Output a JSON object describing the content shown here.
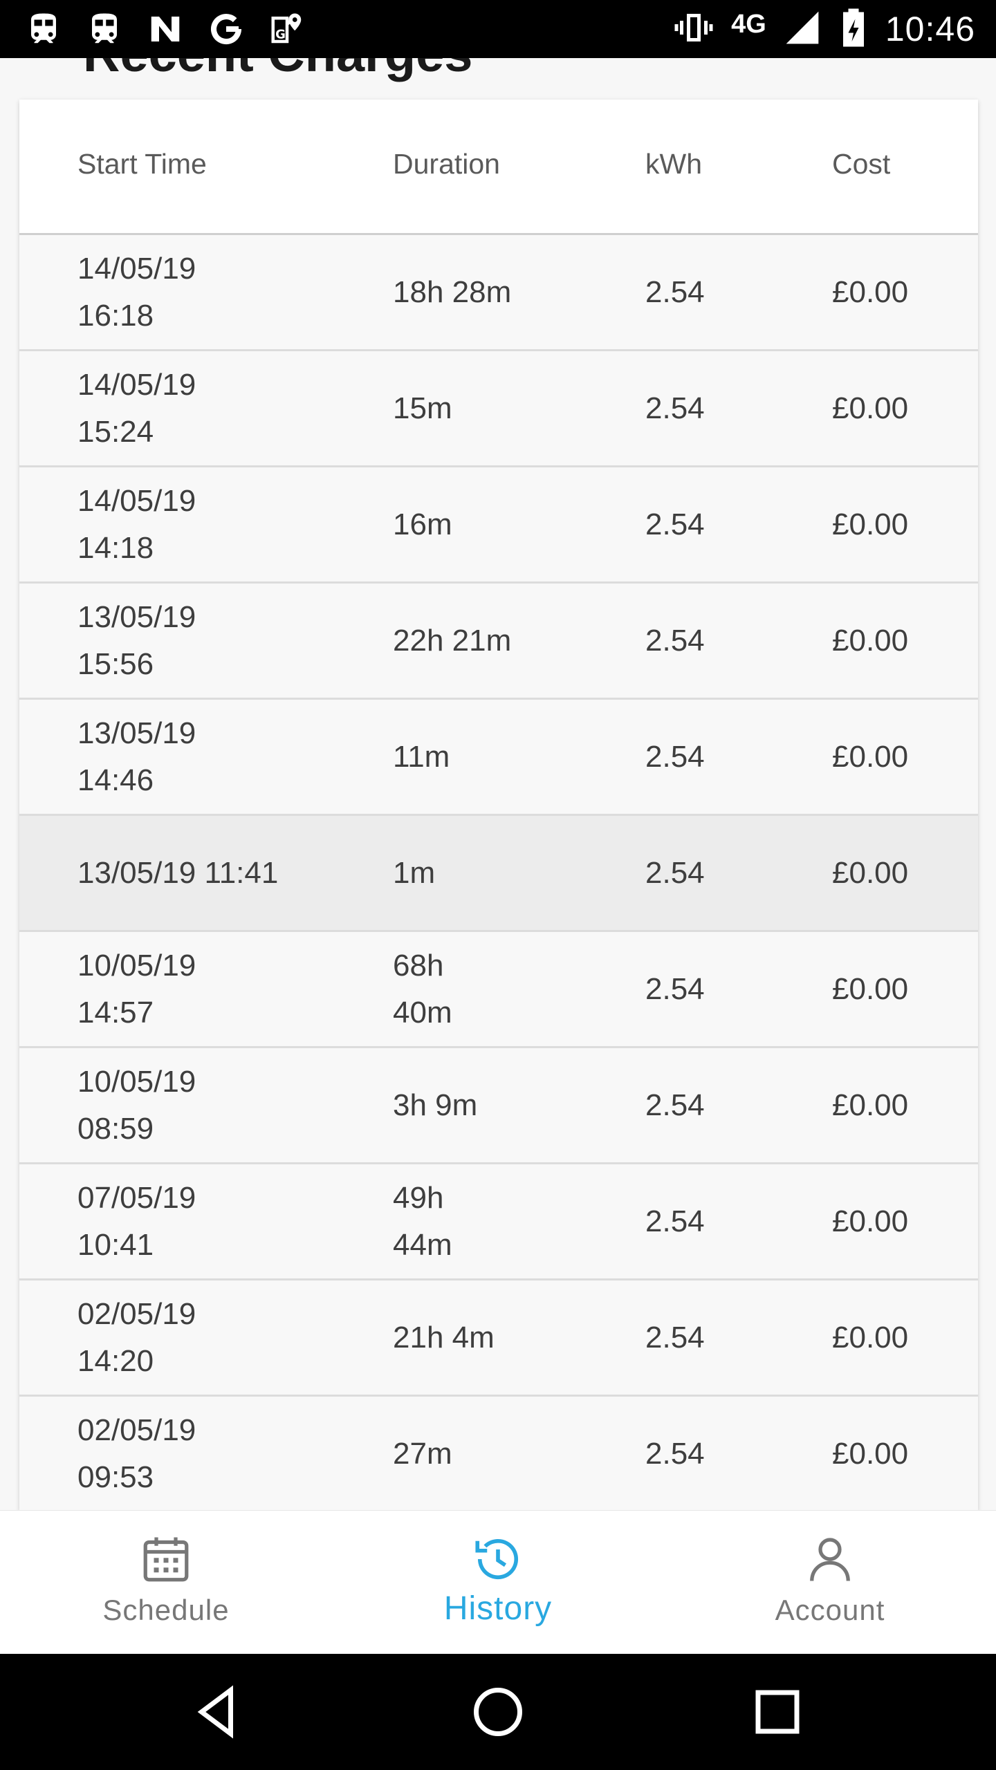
{
  "status_bar": {
    "left_icons": [
      "train-icon",
      "train-icon",
      "news-icon",
      "google-icon",
      "maps-icon"
    ],
    "network": "4G",
    "time": "10:46"
  },
  "page": {
    "title": "Recent Charges"
  },
  "table": {
    "columns": [
      "Start Time",
      "Duration",
      "kWh",
      "Cost"
    ],
    "rows": [
      {
        "date": "14/05/19",
        "time": "16:18",
        "duration": "18h 28m",
        "kwh": "2.54",
        "cost": "£0.00"
      },
      {
        "date": "14/05/19",
        "time": "15:24",
        "duration": "15m",
        "kwh": "2.54",
        "cost": "£0.00"
      },
      {
        "date": "14/05/19",
        "time": "14:18",
        "duration": "16m",
        "kwh": "2.54",
        "cost": "£0.00"
      },
      {
        "date": "13/05/19",
        "time": "15:56",
        "duration": "22h 21m",
        "kwh": "2.54",
        "cost": "£0.00"
      },
      {
        "date": "13/05/19",
        "time": "14:46",
        "duration": "11m",
        "kwh": "2.54",
        "cost": "£0.00"
      },
      {
        "date": "13/05/19 11:41",
        "time": "",
        "duration": "1m",
        "kwh": "2.54",
        "cost": "£0.00"
      },
      {
        "date": "10/05/19",
        "time": "14:57",
        "duration": "68h 40m",
        "kwh": "2.54",
        "cost": "£0.00"
      },
      {
        "date": "10/05/19",
        "time": "08:59",
        "duration": "3h 9m",
        "kwh": "2.54",
        "cost": "£0.00"
      },
      {
        "date": "07/05/19",
        "time": "10:41",
        "duration": "49h 44m",
        "kwh": "2.54",
        "cost": "£0.00"
      },
      {
        "date": "02/05/19",
        "time": "14:20",
        "duration": "21h 4m",
        "kwh": "2.54",
        "cost": "£0.00"
      },
      {
        "date": "02/05/19",
        "time": "09:53",
        "duration": "27m",
        "kwh": "2.54",
        "cost": "£0.00"
      }
    ]
  },
  "bottom_nav": {
    "items": [
      {
        "label": "Schedule",
        "icon": "calendar-icon"
      },
      {
        "label": "History",
        "icon": "history-icon",
        "active": true
      },
      {
        "label": "Account",
        "icon": "user-icon"
      }
    ]
  },
  "colors": {
    "accent": "#29a8e0",
    "inactive": "#777777",
    "highlight_row": "#ececec"
  }
}
